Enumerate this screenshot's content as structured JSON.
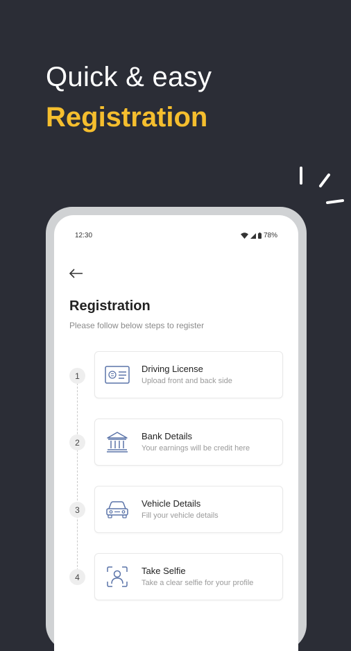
{
  "hero": {
    "line1": "Quick & easy",
    "line2": "Registration"
  },
  "status_bar": {
    "time": "12:30",
    "battery": "78%"
  },
  "page": {
    "title": "Registration",
    "subtitle": "Please follow below steps to register"
  },
  "steps": [
    {
      "num": "1",
      "title": "Driving License",
      "subtitle": "Upload front and back side",
      "icon": "id-card-icon"
    },
    {
      "num": "2",
      "title": "Bank Details",
      "subtitle": "Your earnings will be credit here",
      "icon": "bank-icon"
    },
    {
      "num": "3",
      "title": "Vehicle Details",
      "subtitle": "Fill your vehicle details",
      "icon": "car-icon"
    },
    {
      "num": "4",
      "title": "Take Selfie",
      "subtitle": "Take a clear selfie for your profile",
      "icon": "selfie-icon"
    }
  ],
  "colors": {
    "background": "#2b2d36",
    "accent": "#f5be2e",
    "icon_blue": "#5a73a8"
  }
}
